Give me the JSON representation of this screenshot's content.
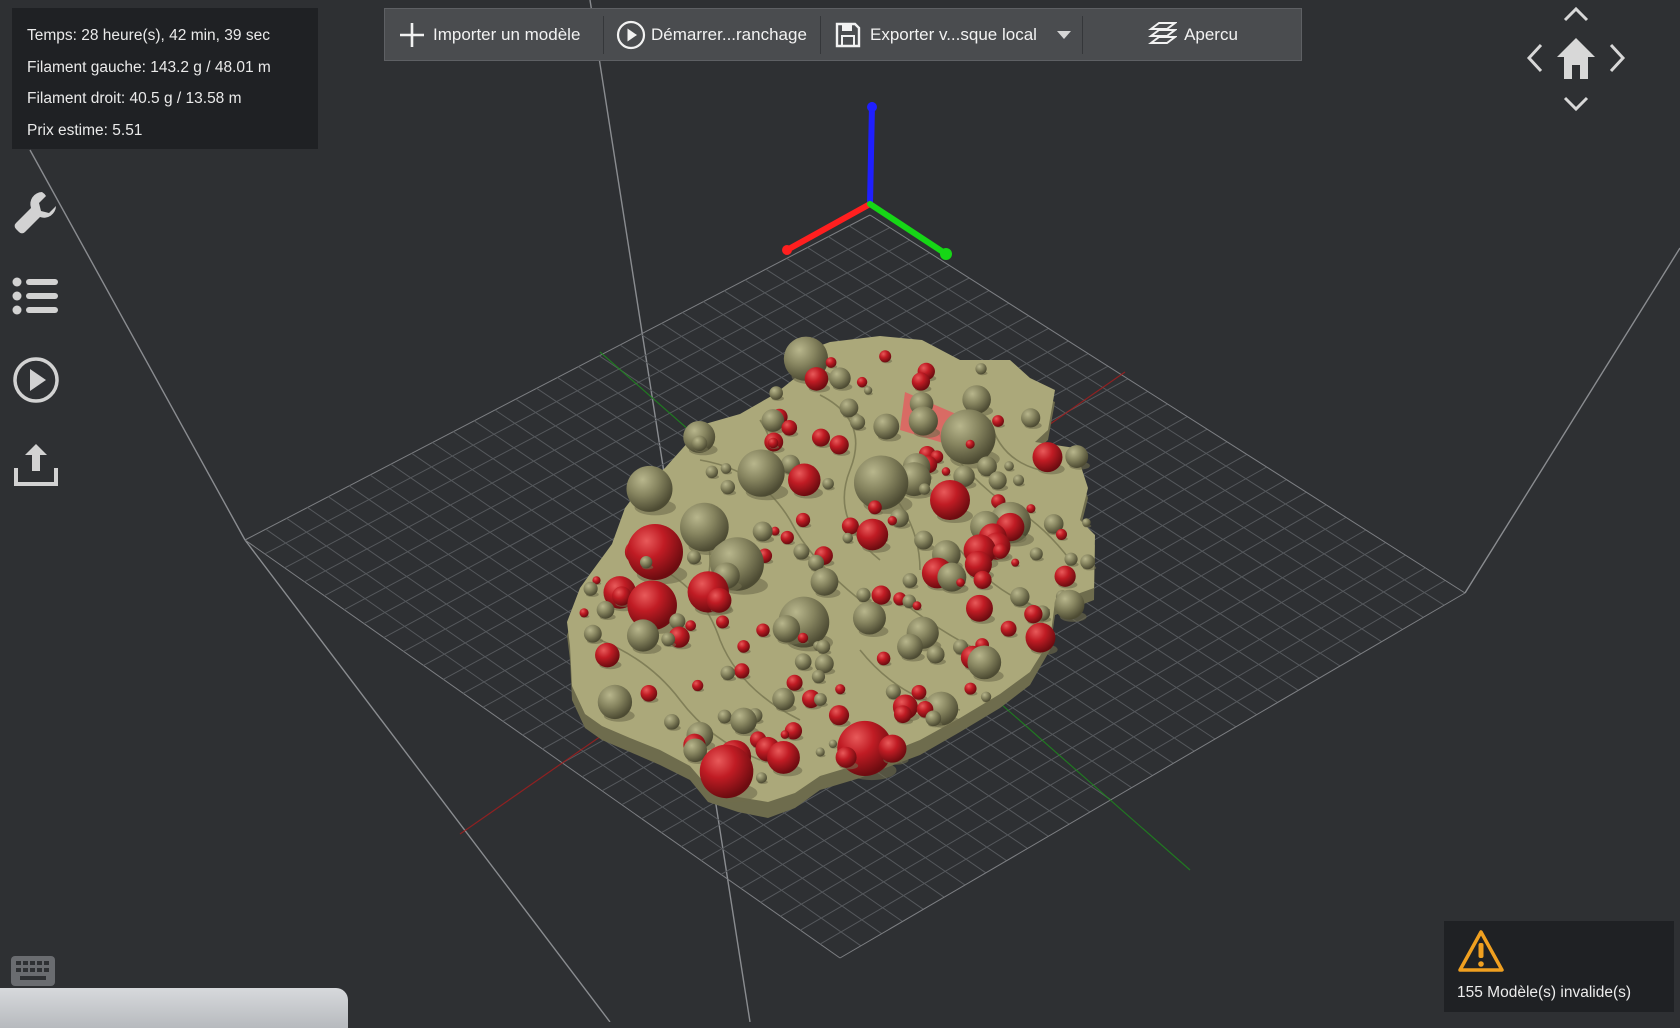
{
  "stats": {
    "time": "Temps: 28 heure(s), 42 min, 39 sec",
    "left_filament": "Filament gauche: 143.2 g / 48.01 m",
    "right_filament": "Filament droit: 40.5 g / 13.58 m",
    "price": "Prix estime: 5.51"
  },
  "toolbar": {
    "import_label": "Importer un modèle",
    "slice_label": "Démarrer...ranchage",
    "export_label": "Exporter v...sque local",
    "preview_label": "Apercu"
  },
  "sidebar": {
    "items": [
      {
        "icon": "wrench-icon"
      },
      {
        "icon": "list-icon"
      },
      {
        "icon": "play-icon"
      },
      {
        "icon": "upload-icon"
      }
    ]
  },
  "navigation": {
    "icons": [
      "chevron-up-icon",
      "chevron-left-icon",
      "home-icon",
      "chevron-right-icon",
      "chevron-down-icon"
    ]
  },
  "warning": {
    "message": "155 Modèle(s) invalide(s)",
    "icon": "warning-icon",
    "color": "#f0a020"
  },
  "scene": {
    "model_color": "#a9a679",
    "support_color": "#b91c24",
    "axis_colors": {
      "x": "#ff1f1f",
      "y": "#16d616",
      "z": "#1f1fff"
    },
    "background": "#2e3033"
  }
}
